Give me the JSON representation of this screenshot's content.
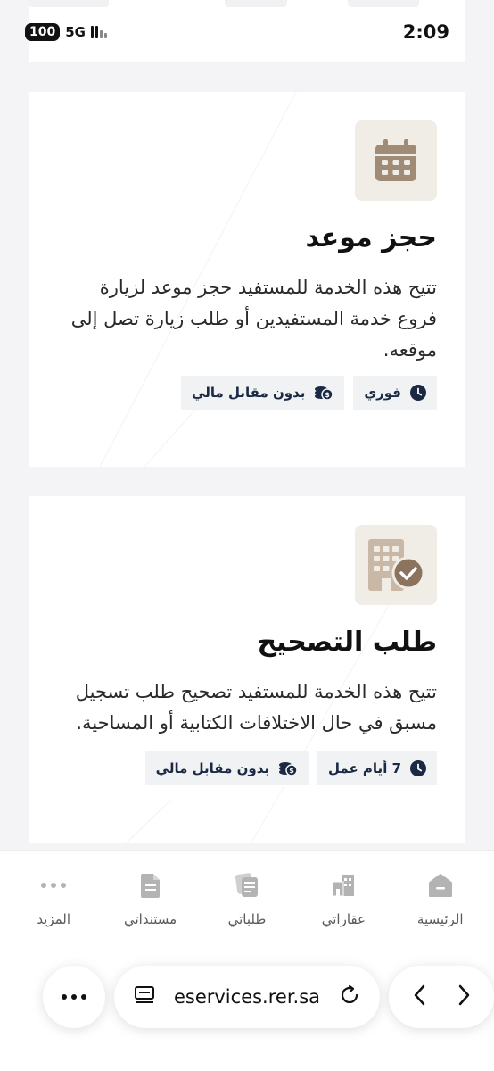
{
  "status": {
    "battery": "100",
    "network": "5G",
    "time": "2:09"
  },
  "services": [
    {
      "icon": "calendar-icon",
      "title": "حجز موعد",
      "description": "تتيح هذه الخدمة للمستفيد حجز موعد لزيارة فروع خدمة المستفيدين أو طلب زيارة تصل إلى موقعه.",
      "duration": "فوري",
      "fee": "بدون مقابل مالي"
    },
    {
      "icon": "building-check-icon",
      "title": "طلب التصحيح",
      "description": "تتيح هذه الخدمة للمستفيد تصحيح طلب تسجيل مسبق في حال الاختلافات الكتابية أو المساحية.",
      "duration": "7 أيام عمل",
      "fee": "بدون مقابل مالي"
    }
  ],
  "bottom_nav": [
    {
      "label": "الرئيسية",
      "icon": "home-icon"
    },
    {
      "label": "عقاراتي",
      "icon": "buildings-icon"
    },
    {
      "label": "طلباتي",
      "icon": "requests-icon"
    },
    {
      "label": "مستنداتي",
      "icon": "document-icon"
    },
    {
      "label": "المزيد",
      "icon": "more-dots-icon"
    }
  ],
  "browser": {
    "url": "eservices.rer.sa"
  },
  "colors": {
    "accent_brown": "#a08b76",
    "chip_text": "#1a2a44",
    "nav_icon": "#b3b3b3"
  }
}
